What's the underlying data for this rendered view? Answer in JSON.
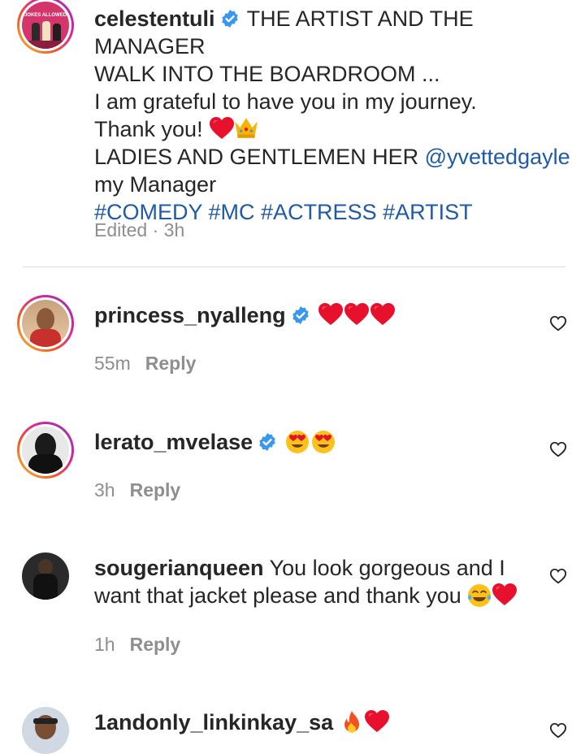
{
  "caption": {
    "username": "celestentuli",
    "line1": "THE ARTIST AND THE MANAGER",
    "line2": "WALK INTO THE BOARDROOM ...",
    "line3": "I am grateful to have you in my journey.",
    "line4": "Thank you!",
    "line5_prefix": "LADIES AND GENTLEMEN HER ",
    "mention": "@yvettedgayle",
    "line6": "my Manager",
    "hashtags": "#COMEDY #MC #ACTRESS #ARTIST",
    "meta": "Edited · 3h",
    "avatar_text": "JOKES ALLOWED"
  },
  "comments": [
    {
      "username": "princess_nyalleng",
      "verified": true,
      "text": "",
      "emojis": [
        "heart",
        "heart",
        "heart"
      ],
      "time": "55m",
      "reply": "Reply"
    },
    {
      "username": "lerato_mvelase",
      "verified": true,
      "text": "",
      "emojis": [
        "heart-eyes",
        "heart-eyes"
      ],
      "time": "3h",
      "reply": "Reply"
    },
    {
      "username": "sougerianqueen",
      "verified": false,
      "text_line1": "You look gorgeous and I",
      "text_line2": "want that jacket please and thank you",
      "emojis": [
        "tears-of-joy",
        "heart"
      ],
      "time": "1h",
      "reply": "Reply"
    },
    {
      "username": "1andonly_linkinkay_sa",
      "verified": false,
      "text": "",
      "emojis": [
        "fire",
        "heart"
      ]
    }
  ],
  "colors": {
    "link": "#1f5aa6",
    "muted": "#8e8e8e",
    "verified": "#3897f0",
    "heart": "#e8112d"
  }
}
